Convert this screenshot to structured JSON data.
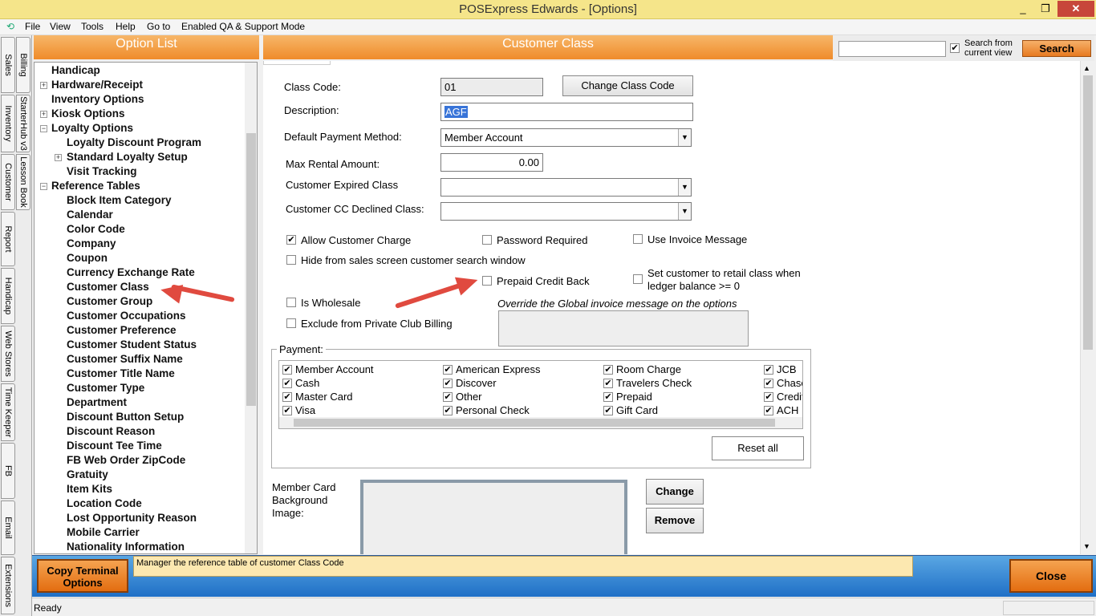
{
  "window": {
    "title": "POSExpress Edwards - [Options]",
    "min": "_",
    "restore": "❐",
    "close": "✕"
  },
  "menu": {
    "items": [
      "File",
      "View",
      "Tools",
      "Help",
      "Go to",
      "Enabled QA & Support Mode"
    ]
  },
  "side_tabs": [
    "Billing",
    "Sales",
    "StarterHub v3",
    "Inventory",
    "Lesson Book",
    "Customer",
    "Report",
    "Handicap",
    "Web Stores",
    "Time Keeper",
    "FB",
    "Email",
    "Extensions"
  ],
  "option_list": {
    "title": "Option List",
    "items": [
      "Handicap",
      "Hardware/Receipt",
      "Inventory Options",
      "Kiosk Options",
      "Loyalty Options",
      "Loyalty Discount Program",
      "Standard Loyalty Setup",
      "Visit Tracking",
      "Reference Tables",
      "Block Item Category",
      "Calendar",
      "Color Code",
      "Company",
      "Coupon",
      "Currency Exchange Rate",
      "Customer Class",
      "Customer Group",
      "Customer Occupations",
      "Customer Preference",
      "Customer Student Status",
      "Customer Suffix Name",
      "Customer Title Name",
      "Customer Type",
      "Department",
      "Discount Button Setup",
      "Discount Reason",
      "Discount Tee Time",
      "FB Web Order ZipCode",
      "Gratuity",
      "Item Kits",
      "Location Code",
      "Lost Opportunity Reason",
      "Mobile Carrier",
      "Nationality Information"
    ]
  },
  "header": {
    "title": "Customer Class",
    "search_from": "Search from",
    "current_view": "current view",
    "search_button": "Search",
    "search_value": ""
  },
  "form": {
    "class_code_label": "Class Code:",
    "class_code": "01",
    "change_class_code": "Change Class Code",
    "description_label": "Description:",
    "description": "AGF",
    "default_payment_label": "Default Payment Method:",
    "default_payment": "Member Account",
    "max_rental_label": "Max Rental Amount:",
    "max_rental": "0.00",
    "expired_class_label": "Customer  Expired Class",
    "expired_class": "",
    "cc_declined_label": "Customer CC Declined Class:",
    "cc_declined": "",
    "allow_charge": "Allow Customer Charge",
    "password_required": "Password Required",
    "use_invoice_message": "Use Invoice Message",
    "hide_from_search": "Hide from sales screen customer search window",
    "prepaid_credit_back": "Prepaid Credit Back",
    "set_retail_1": "Set customer to retail class when",
    "set_retail_2": "ledger balance >= 0",
    "is_wholesale": "Is Wholesale",
    "override_label": "Override the Global invoice message on the options",
    "exclude_private": "Exclude from Private Club Billing"
  },
  "payment": {
    "legend": "Payment:",
    "columns": [
      [
        "Member Account",
        "Cash",
        "Master Card",
        "Visa"
      ],
      [
        "American Express",
        "Discover",
        "Other",
        "Personal Check"
      ],
      [
        "Room Charge",
        "Travelers Check",
        "Prepaid",
        "Gift Card"
      ],
      [
        "JCB",
        "Chase",
        "Credit",
        "ACH"
      ]
    ],
    "reset_all": "Reset all"
  },
  "member_card": {
    "label_1": "Member Card",
    "label_2": "Background",
    "label_3": "Image:",
    "change": "Change",
    "remove": "Remove"
  },
  "footer": {
    "copy_terminal_1": "Copy Terminal",
    "copy_terminal_2": "Options",
    "message": "Manager the reference table of customer Class Code",
    "close": "Close"
  },
  "status": {
    "text": "Ready"
  },
  "colors": {
    "accent_orange": "#ef8b2a",
    "footer_blue": "#1f6fc6",
    "annotation_arrow": "#e04a3f"
  }
}
